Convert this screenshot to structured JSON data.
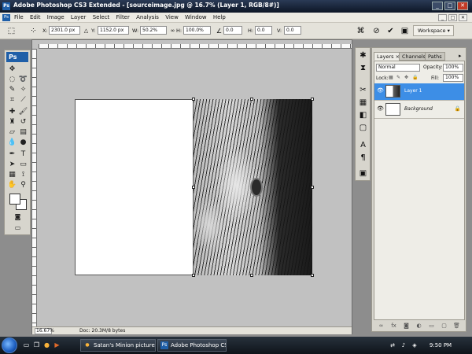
{
  "window": {
    "app_badge": "Ps",
    "title": "Adobe Photoshop CS3 Extended - [sourceimage.jpg @ 16.7% (Layer 1, RGB/8#)]",
    "minimize": "_",
    "maximize": "□",
    "close": "✕"
  },
  "menu": {
    "items": [
      "File",
      "Edit",
      "Image",
      "Layer",
      "Select",
      "Filter",
      "Analysis",
      "View",
      "Window",
      "Help"
    ]
  },
  "options": {
    "x_label": "X:",
    "x_value": "2301.0 px",
    "y_label": "Y:",
    "y_value": "1152.0 px",
    "w_label": "W:",
    "w_value": "50.2%",
    "h_label": "H:",
    "h_value": "100.0%",
    "angle_value": "0.0",
    "hskew_label": "H:",
    "hskew_value": "0.0",
    "vskew_label": "V:",
    "vskew_value": "0.0",
    "workspace_label": "Workspace ▾"
  },
  "tools": {
    "logo": "Ps",
    "foreground_color": "#ffffff",
    "background_color": "#ffffff"
  },
  "document": {
    "zoom": "16.67%",
    "doc_info": "Doc: 20.3M/8 bytes"
  },
  "layers_panel": {
    "tabs": [
      "Layers ×",
      "Channels",
      "Paths"
    ],
    "blend_mode": "Normal",
    "opacity_label": "Opacity:",
    "opacity_value": "100%",
    "lock_label": "Lock:",
    "fill_label": "Fill:",
    "fill_value": "100%",
    "layers": [
      {
        "name": "Layer 1",
        "selected": true
      },
      {
        "name": "Background",
        "selected": false
      }
    ]
  },
  "taskbar": {
    "tasks": [
      {
        "label": "Satan's Minion picture ..."
      },
      {
        "label": "Adobe Photoshop CS3 ..."
      }
    ],
    "time": "9:50 PM"
  }
}
